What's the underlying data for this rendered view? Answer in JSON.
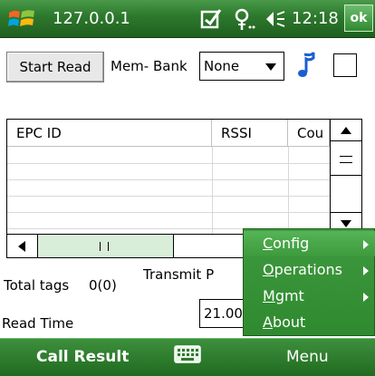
{
  "titlebar": {
    "title": "127.0.0.1",
    "clock": "12:18",
    "ok_label": "ok",
    "icons": [
      "windows-logo-icon",
      "connectivity-icon",
      "signal-icon",
      "volume-icon"
    ]
  },
  "toolbar": {
    "start_read_label": "Start Read",
    "membank_label": "Mem- Bank",
    "membank_value": "None"
  },
  "table": {
    "columns": [
      "EPC ID",
      "RSSI",
      "Cou"
    ],
    "rows": []
  },
  "form": {
    "total_tags_label": "Total tags",
    "total_tags_value": "0(0)",
    "transmit_label": "Transmit P",
    "read_time_label": "Read Time",
    "read_time_value": "21.00"
  },
  "popup_menu": {
    "items": [
      {
        "label": "Config",
        "underline": "C",
        "rest": "onfig",
        "has_submenu": true
      },
      {
        "label": "Operations",
        "underline": "O",
        "rest": "perations",
        "has_submenu": true
      },
      {
        "label": "Mgmt",
        "underline": "M",
        "rest": "gmt",
        "has_submenu": true
      },
      {
        "label": "About",
        "underline": "A",
        "rest": "bout",
        "has_submenu": false
      }
    ]
  },
  "softkeys": {
    "left_label": "Call Result",
    "right_label": "Menu"
  },
  "colors": {
    "bar_green": "#2e7a2e",
    "menu_green": "#2f8a2f",
    "highlight_green": "#55b455"
  }
}
